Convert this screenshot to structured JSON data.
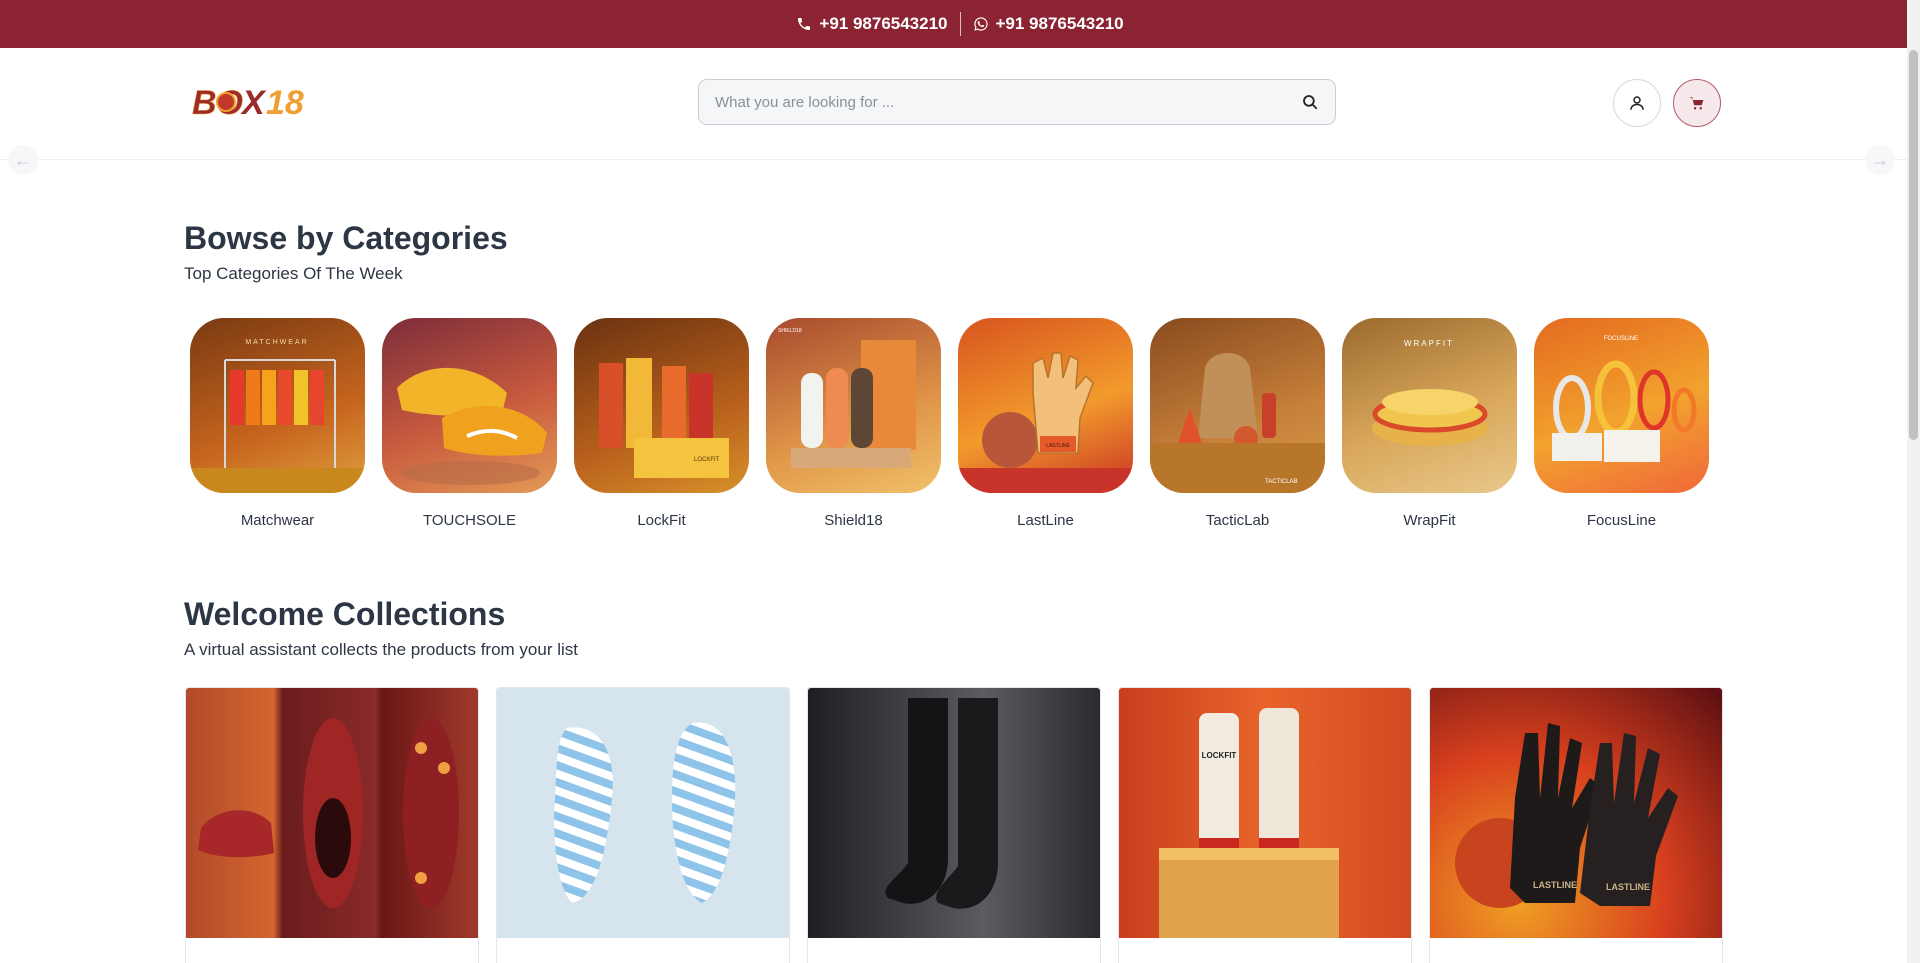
{
  "topbar": {
    "phone": "+91 9876543210",
    "whatsapp": "+91 9876543210"
  },
  "header": {
    "logo_text": "BOX18",
    "search": {
      "placeholder": "What you are looking for ..."
    }
  },
  "categories_section": {
    "title": "Bowse by Categories",
    "subtitle": "Top Categories Of The Week",
    "items": [
      {
        "label": "Matchwear",
        "caption": "MATCHWEAR",
        "icon": "shirts-rack-image"
      },
      {
        "label": "TOUCHSOLE",
        "caption": "",
        "icon": "football-boots-image"
      },
      {
        "label": "LockFit",
        "caption": "LOCKFIT",
        "icon": "socks-box-image"
      },
      {
        "label": "Shield18",
        "caption": "SHIELD18",
        "icon": "shin-guards-image"
      },
      {
        "label": "LastLine",
        "caption": "LASTLINE",
        "icon": "goalkeeper-gloves-image"
      },
      {
        "label": "TacticLab",
        "caption": "TACTICLAB",
        "icon": "training-gear-image"
      },
      {
        "label": "WrapFit",
        "caption": "WRAPFIT",
        "icon": "wristbands-image"
      },
      {
        "label": "FocusLine",
        "caption": "FOCUSLINE",
        "icon": "headbands-image"
      }
    ]
  },
  "collections_section": {
    "title": "Welcome Collections",
    "subtitle": "A virtual assistant collects the products from your list",
    "items": [
      {
        "icon": "red-football-boots-image",
        "caption": ""
      },
      {
        "icon": "striped-boots-image",
        "caption": ""
      },
      {
        "icon": "black-socks-image",
        "caption": ""
      },
      {
        "icon": "lockfit-socks-image",
        "caption": "LOCKFIT"
      },
      {
        "icon": "lastline-gloves-image",
        "caption": "LASTLINE"
      }
    ]
  },
  "colors": {
    "brand": "#8b2332",
    "text": "#2d3645",
    "accent_orange": "#f0a032"
  }
}
